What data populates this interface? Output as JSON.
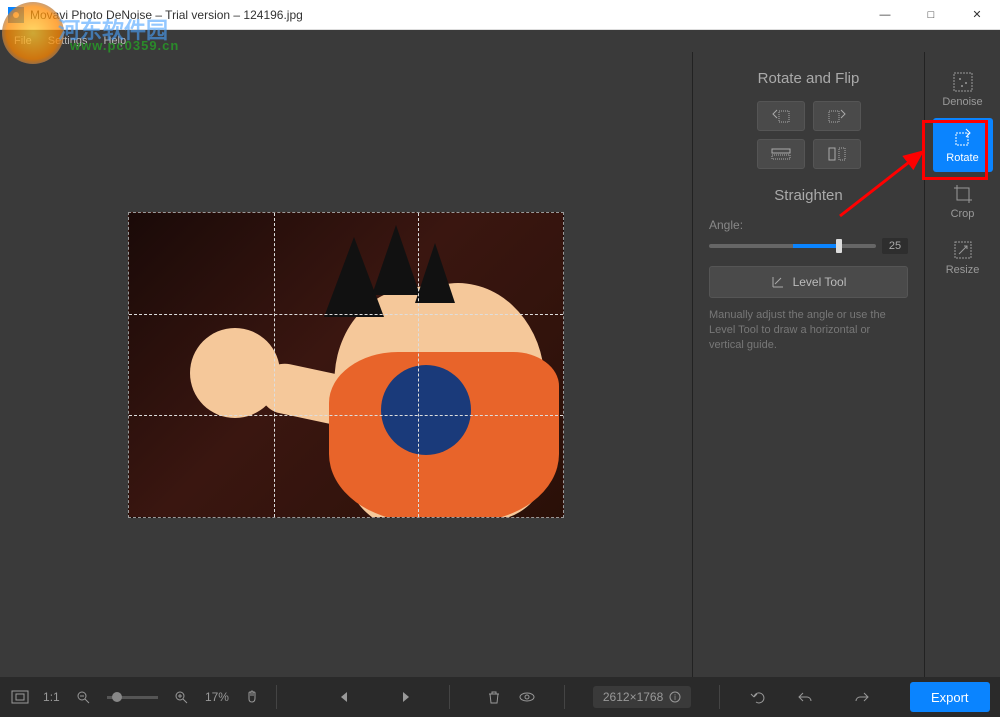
{
  "window": {
    "title": "Movavi Photo DeNoise – Trial version – 124196.jpg",
    "min": "—",
    "max": "□",
    "close": "✕"
  },
  "menu": {
    "file": "File",
    "settings": "Settings",
    "help": "Help"
  },
  "panel": {
    "rotate_flip": "Rotate and Flip",
    "straighten": "Straighten",
    "angle_label": "Angle:",
    "angle_value": "25",
    "level_tool": "Level Tool",
    "hint": "Manually adjust the angle or use the Level Tool to draw a horizontal or vertical guide."
  },
  "tabs": {
    "denoise": "Denoise",
    "rotate": "Rotate",
    "crop": "Crop",
    "resize": "Resize"
  },
  "bottom": {
    "fit": "1:1",
    "zoom": "17%",
    "dimensions": "2612×1768",
    "export": "Export"
  },
  "watermark": {
    "text1": "河东软件园",
    "text2": "www.pc0359.cn"
  }
}
